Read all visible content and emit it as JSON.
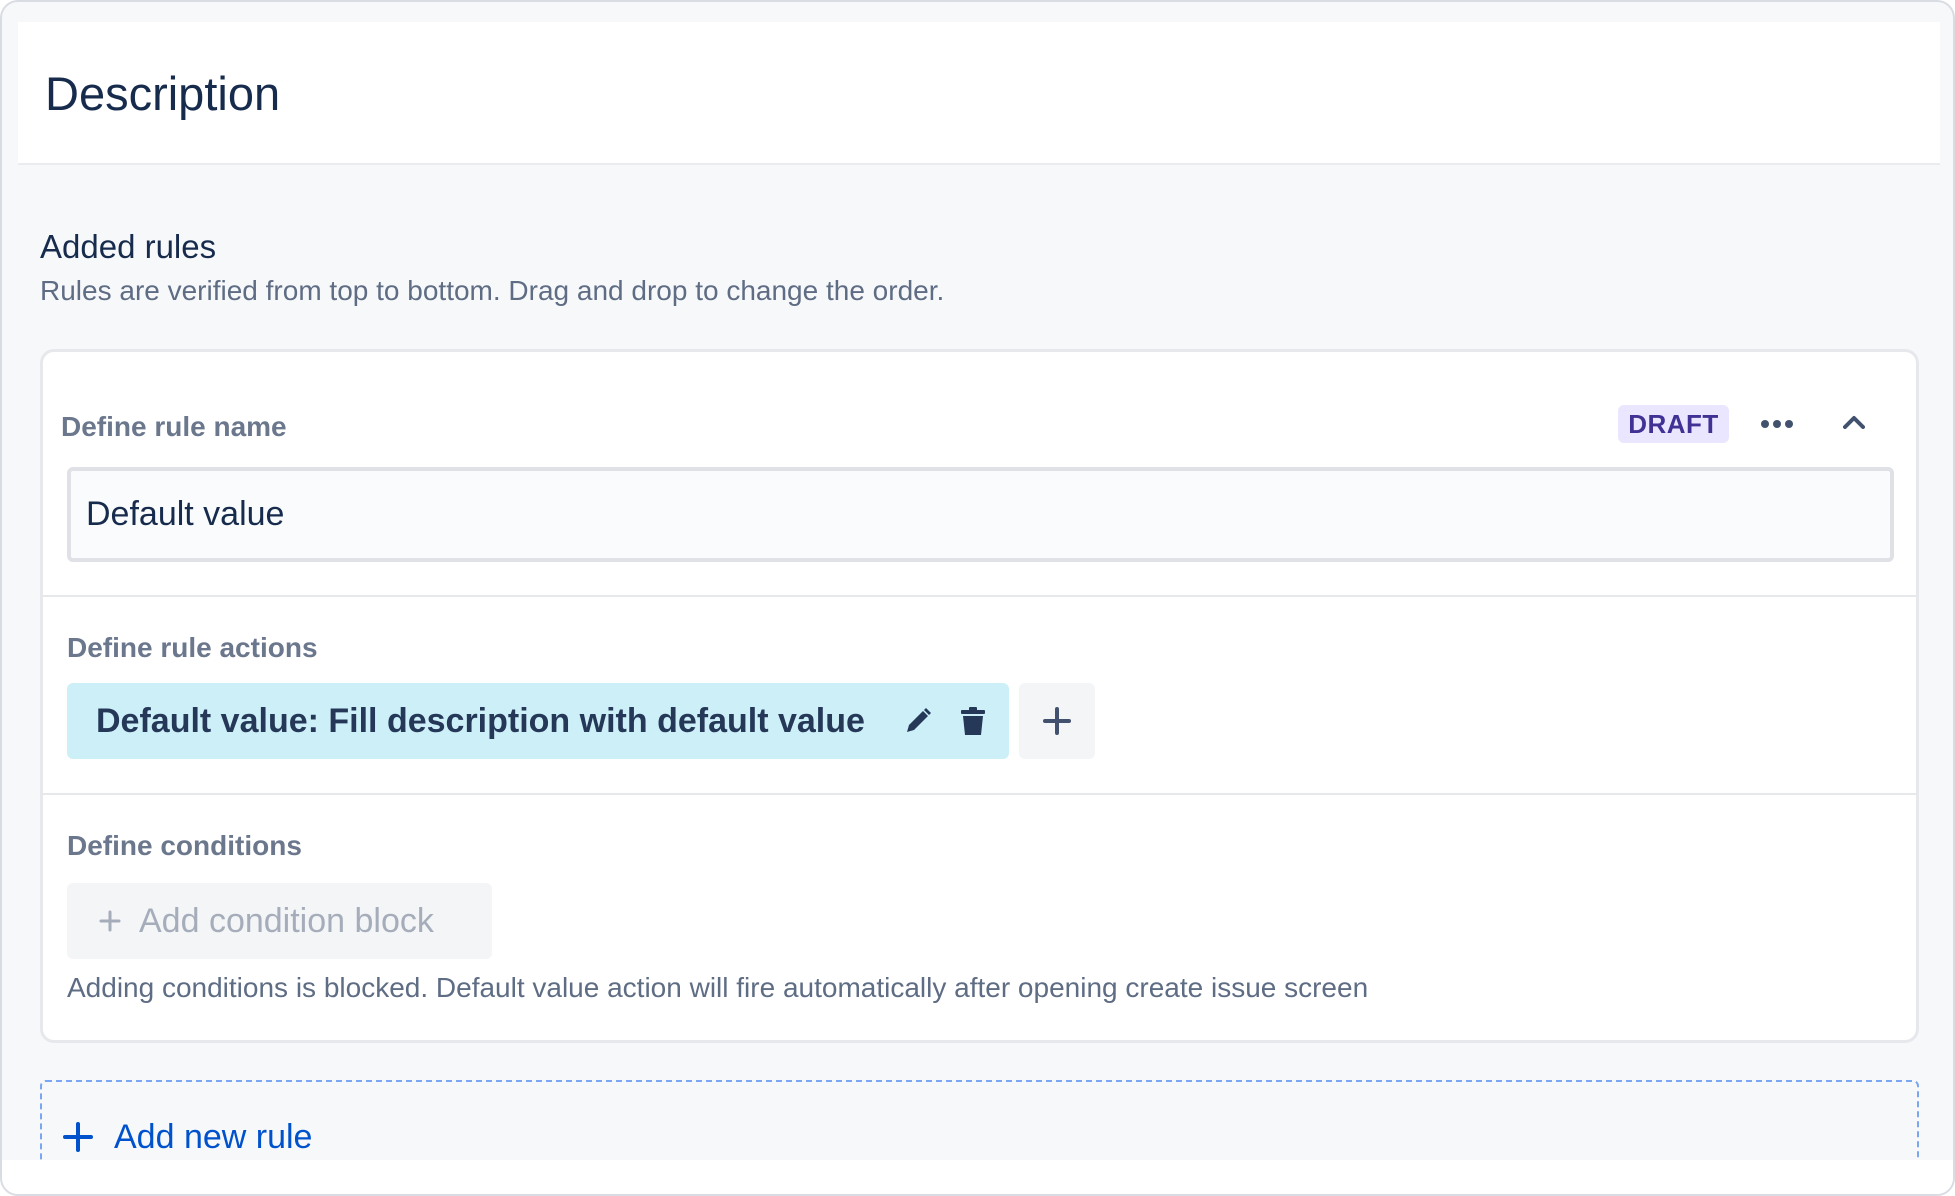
{
  "header": {
    "title": "Description"
  },
  "section": {
    "title": "Added rules",
    "subtitle": "Rules are verified from top to bottom. Drag and drop to change the order."
  },
  "rule": {
    "name_label": "Define rule name",
    "status_badge": "DRAFT",
    "name_value": "Default value",
    "actions_label": "Define rule actions",
    "action_chip": "Default value: Fill description with default value",
    "conditions_label": "Define conditions",
    "add_condition_label": "Add condition block",
    "conditions_note": "Adding conditions is blocked. Default value action will fire automatically after opening create issue screen"
  },
  "new_rule": {
    "label": "Add new rule"
  },
  "colors": {
    "title": "#172b4d",
    "badge_bg": "#eae6ff",
    "badge_text": "#403294",
    "chip_bg": "#cdf0f8",
    "link": "#0052cc"
  },
  "icons": [
    "more-horizontal-icon",
    "chevron-up-icon",
    "pencil-icon",
    "trash-icon",
    "plus-icon"
  ]
}
